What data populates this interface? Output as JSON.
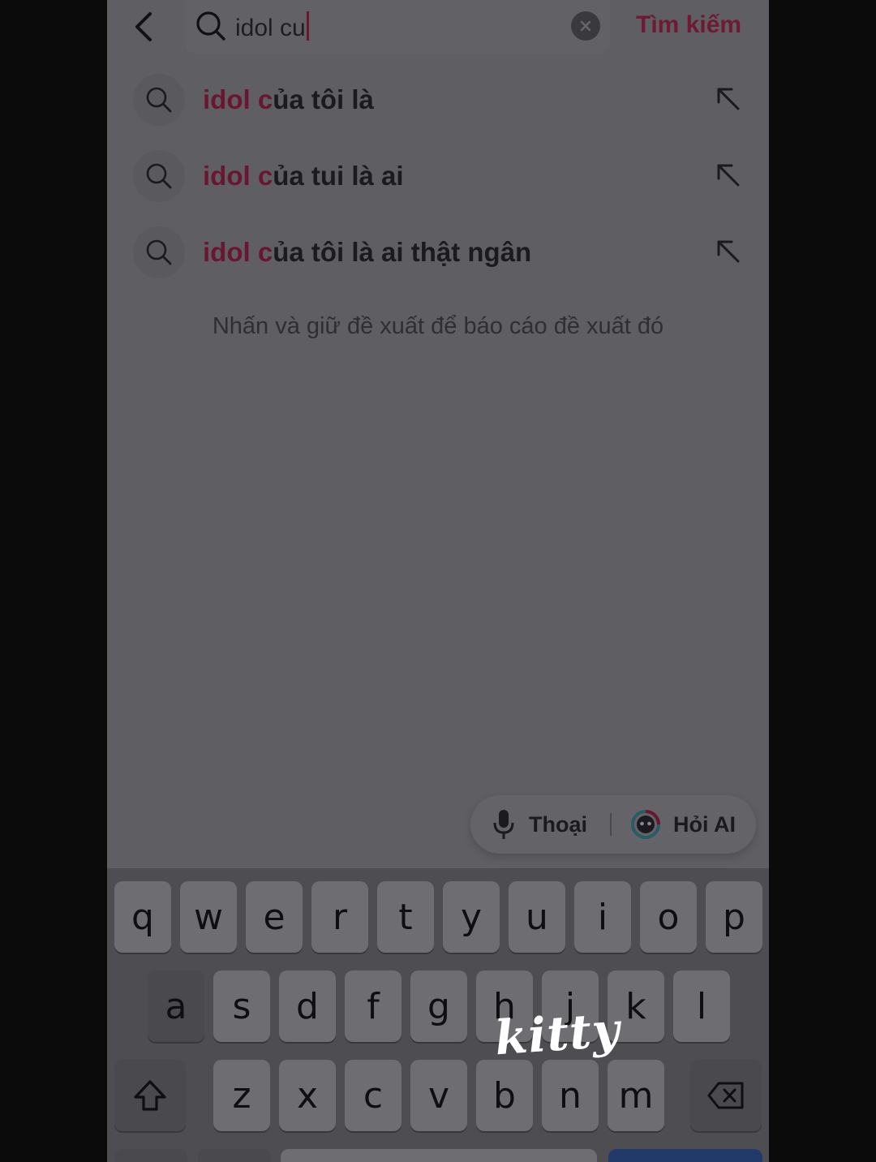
{
  "search": {
    "query": "idol cu",
    "submit_label": "Tìm kiếm"
  },
  "suggestions": [
    {
      "highlight": "idol c",
      "rest": "ủa tôi là"
    },
    {
      "highlight": "idol c",
      "rest": "ủa tui là ai"
    },
    {
      "highlight": "idol c",
      "rest": "ủa tôi là ai thật ngân"
    }
  ],
  "hint": "Nhấn và giữ đề xuất để báo cáo đề xuất đó",
  "actions": {
    "voice_label": "Thoại",
    "ai_label": "Hỏi AI"
  },
  "keyboard": {
    "row1": [
      "q",
      "w",
      "e",
      "r",
      "t",
      "y",
      "u",
      "i",
      "o",
      "p"
    ],
    "row2": [
      "a",
      "s",
      "d",
      "f",
      "g",
      "h",
      "j",
      "k",
      "l"
    ],
    "row3": [
      "z",
      "x",
      "c",
      "v",
      "b",
      "n",
      "m"
    ]
  },
  "overlay": {
    "watermark": "kitty"
  },
  "colors": {
    "accent": "#6e1a32",
    "background": "#5f5f63",
    "keyboard": "#4e4e52"
  }
}
